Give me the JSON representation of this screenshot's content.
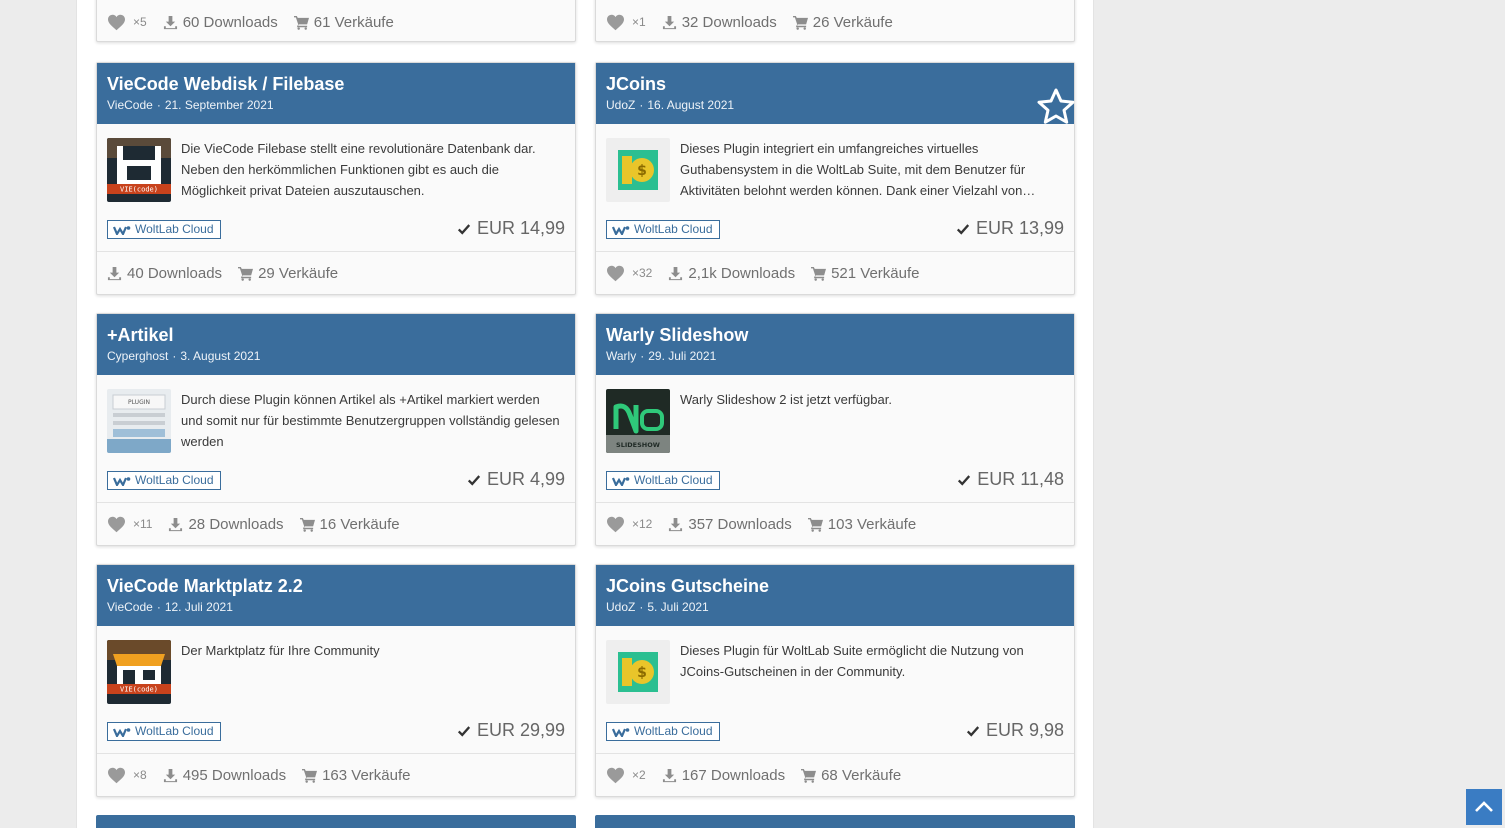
{
  "partial_top_cards": [
    {
      "likes": "×5",
      "downloads": "60 Downloads",
      "sales": "61 Verkäufe"
    },
    {
      "likes": "×1",
      "downloads": "32 Downloads",
      "sales": "26 Verkäufe"
    }
  ],
  "cards": [
    {
      "title": "VieCode Webdisk / Filebase",
      "author": "VieCode",
      "date": "21. September 2021",
      "description": "Die VieCode Filebase stellt eine revolutionäre Datenbank dar. Neben den herkömmlichen Funktionen gibt es auch die Möglichkeit privat Dateien auszutauschen.",
      "badge": "WoltLab Cloud",
      "price": "EUR 14,99",
      "likes": "",
      "downloads": "40 Downloads",
      "sales": "29 Verkäufe",
      "thumb": "viecode-filebase"
    },
    {
      "title": "JCoins",
      "author": "UdoZ",
      "date": "16. August 2021",
      "description": "Dieses Plugin integriert ein umfangreiches virtuelles Guthabensystem in die WoltLab Suite, mit dem Benutzer für Aktivitäten belohnt werden können. Dank einer Vielzahl von…",
      "badge": "WoltLab Cloud",
      "price": "EUR 13,99",
      "likes": "×32",
      "downloads": "2,1k Downloads",
      "sales": "521 Verkäufe",
      "thumb": "jcoins",
      "featured": true
    },
    {
      "title": "+Artikel",
      "author": "Cyperghost",
      "date": "3. August 2021",
      "description": "Durch diese Plugin können Artikel als +Artikel markiert werden und somit nur für bestimmte Benutzergruppen vollständig gelesen werden",
      "badge": "WoltLab Cloud",
      "price": "EUR 4,99",
      "likes": "×11",
      "downloads": "28 Downloads",
      "sales": "16 Verkäufe",
      "thumb": "plus-artikel"
    },
    {
      "title": "Warly Slideshow",
      "author": "Warly",
      "date": "29. Juli 2021",
      "description": "Warly Slideshow 2 ist jetzt verfügbar.",
      "badge": "WoltLab Cloud",
      "price": "EUR 11,48",
      "likes": "×12",
      "downloads": "357 Downloads",
      "sales": "103 Verkäufe",
      "thumb": "warly-slideshow"
    },
    {
      "title": "VieCode Marktplatz 2.2",
      "author": "VieCode",
      "date": "12. Juli 2021",
      "description": "Der Marktplatz für Ihre Community",
      "badge": "WoltLab Cloud",
      "price": "EUR 29,99",
      "likes": "×8",
      "downloads": "495 Downloads",
      "sales": "163 Verkäufe",
      "thumb": "viecode-marktplatz"
    },
    {
      "title": "JCoins Gutscheine",
      "author": "UdoZ",
      "date": "5. Juli 2021",
      "description": "Dieses Plugin für WoltLab Suite ermöglicht die Nutzung von JCoins-Gutscheinen in der Community.",
      "badge": "WoltLab Cloud",
      "price": "EUR 9,98",
      "likes": "×2",
      "downloads": "167 Downloads",
      "sales": "68 Verkäufe",
      "thumb": "jcoins"
    }
  ],
  "thumb_text": {
    "viecode": "VIE(code)",
    "plugin": "PLUGIN",
    "slideshow": "SLIDESHOW"
  },
  "colors": {
    "header": "#3a6d9c",
    "scroll_button": "#3a7cc3"
  }
}
